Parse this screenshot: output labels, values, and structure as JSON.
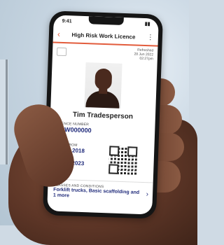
{
  "status": {
    "time": "9:41"
  },
  "app": {
    "title": "High Risk Work Licence",
    "back": "‹",
    "more": "⋮"
  },
  "refresh": {
    "line1": "Refreshed",
    "line2": "28 Jun 2022",
    "line3": "02:27pm"
  },
  "holder": {
    "name": "Tim Tradesperson"
  },
  "licence": {
    "label": "LICENCE NUMBER",
    "number": "HRW000000"
  },
  "valid": {
    "label": "VALID FROM",
    "date": "15 Jul 2018"
  },
  "expires": {
    "label": "EXPIRES",
    "date": "15 Jul 2023"
  },
  "conditions": {
    "label": "CLASSES AND CONDITIONS",
    "value": "Forklift trucks, Basic scaffolding and 1 more",
    "chevron": "›"
  },
  "colors": {
    "accent": "#e25c3c",
    "ink": "#1f2a7a"
  }
}
